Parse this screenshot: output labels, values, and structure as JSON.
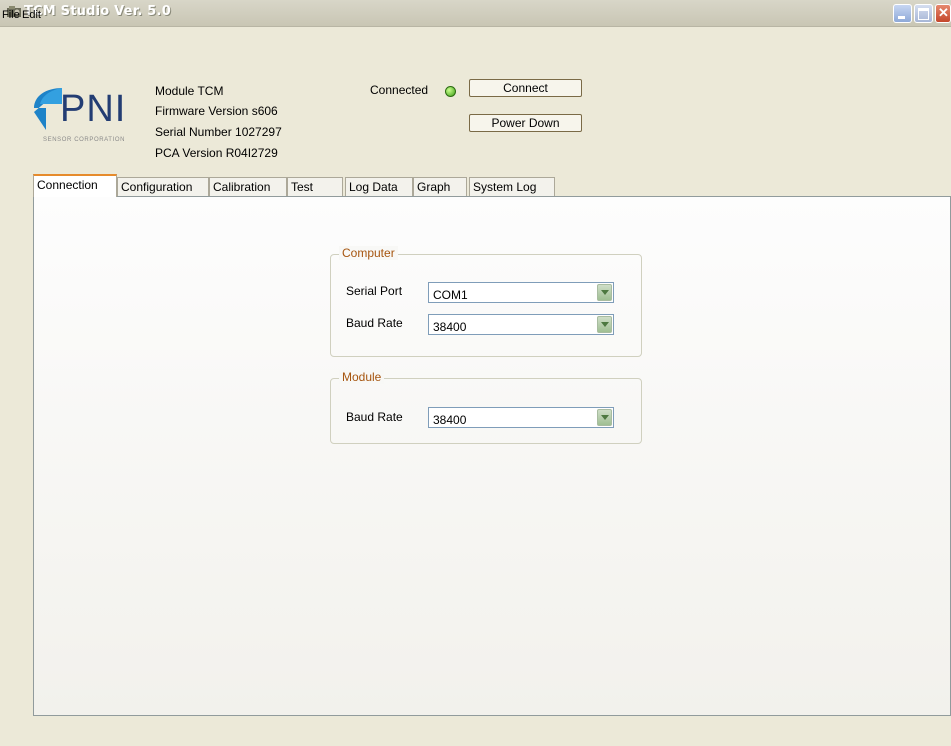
{
  "window": {
    "title": "TCM Studio Ver. 5.0"
  },
  "menu": {
    "file": "File",
    "edit": "Edit"
  },
  "logo": {
    "text": "PNI",
    "sub": "SENSOR CORPORATION"
  },
  "module_info": {
    "module": "Module TCM",
    "firmware": "Firmware Version s606",
    "serial": "Serial Number 1027297",
    "pca": "PCA Version R04I2729"
  },
  "status": {
    "connected_label": "Connected",
    "led_color": "#3c9d15"
  },
  "buttons": {
    "connect": "Connect",
    "power_down": "Power Down"
  },
  "tabs": [
    {
      "label": "Connection",
      "active": true
    },
    {
      "label": "Configuration"
    },
    {
      "label": "Calibration"
    },
    {
      "label": "Test"
    },
    {
      "label": "Log Data"
    },
    {
      "label": "Graph"
    },
    {
      "label": "System Log"
    }
  ],
  "computer_group": {
    "title": "Computer",
    "serial_port_label": "Serial Port",
    "serial_port_value": "COM1",
    "baud_rate_label": "Baud Rate",
    "baud_rate_value": "38400"
  },
  "module_group": {
    "title": "Module",
    "baud_rate_label": "Baud Rate",
    "baud_rate_value": "38400"
  }
}
